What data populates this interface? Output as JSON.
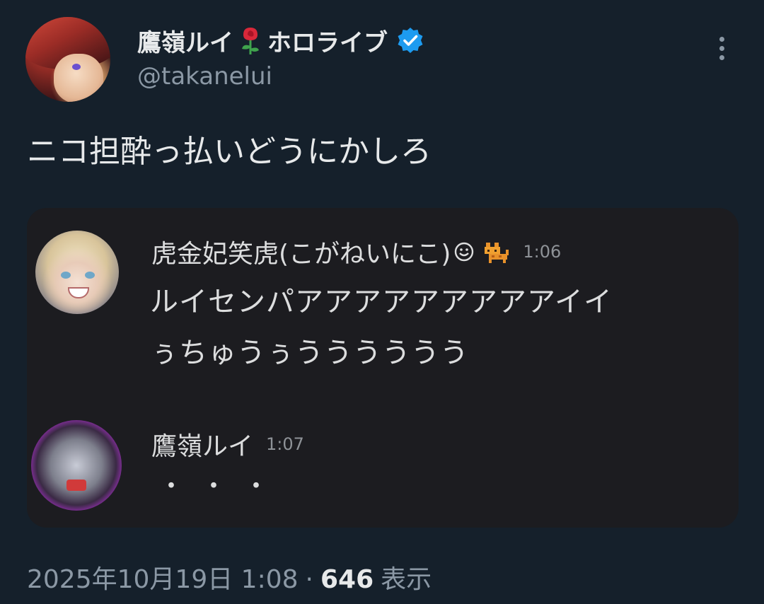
{
  "author": {
    "display_name_prefix": "鷹嶺ルイ",
    "display_name_suffix": "ホロライブ",
    "handle": "@takanelui",
    "verified_color": "#1d9bf0"
  },
  "tweet": {
    "text": "ニコ担酔っ払いどうにかしろ"
  },
  "media": {
    "messages": [
      {
        "name": "虎金妃笑虎(こがねいにこ)",
        "time": "1:06",
        "lines": [
          "ルイセンパアアアアアアアアアイイ",
          "ぅちゅうぅうううううう"
        ]
      },
      {
        "name": "鷹嶺ルイ",
        "time": "1:07",
        "lines": [
          "・・・"
        ]
      }
    ]
  },
  "footer": {
    "datetime": "2025年10月19日 1:08",
    "separator": "·",
    "view_count": "646",
    "view_label": "表示"
  },
  "colors": {
    "background": "#15202b",
    "media_background": "#1c1c20",
    "text_primary": "#e7e9ea",
    "text_secondary": "#8b98a5"
  }
}
